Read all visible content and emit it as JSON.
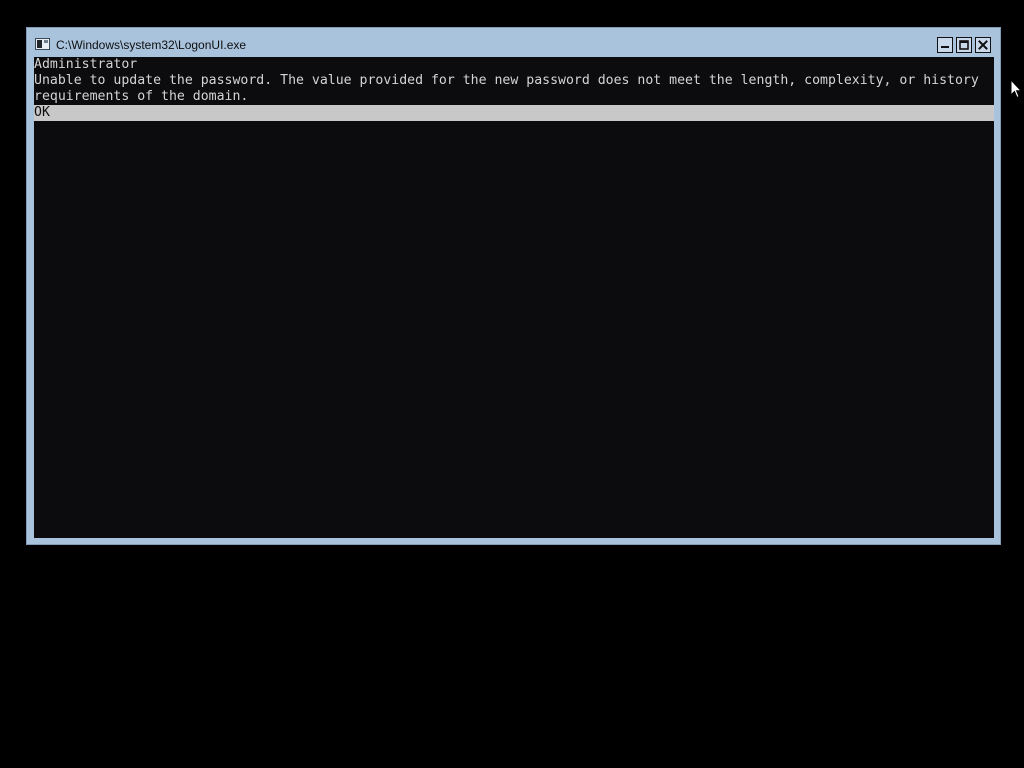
{
  "window": {
    "title": "C:\\Windows\\system32\\LogonUI.exe",
    "icon": "console-window-icon",
    "controls": [
      "minimize-icon",
      "maximize-icon",
      "close-icon"
    ],
    "chrome_color": "#a9c3dd"
  },
  "console": {
    "background": "#0c0c0e",
    "text_color": "#d4d4d4",
    "user_line": "Administrator",
    "message_line": "Unable to update the password. The value provided for the new password does not meet the length, complexity, or history requirements of the domain.",
    "ok_option": "OK",
    "ok_highlight_color": "#c8c8c8"
  },
  "desktop": {
    "background": "#000000",
    "cursor": "mouse-pointer-icon"
  }
}
